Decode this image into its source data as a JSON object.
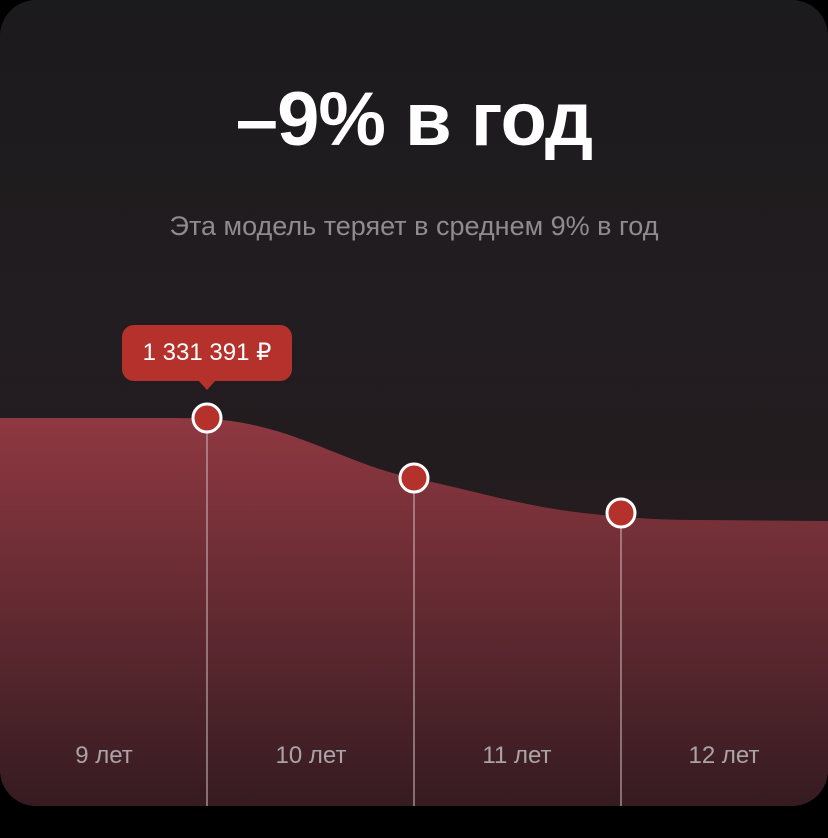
{
  "headline": "–9% в год",
  "subtitle": "Эта модель теряет в среднем 9% в год",
  "tooltip": {
    "value": "1 331 391 ₽"
  },
  "colors": {
    "accent": "#b5312c",
    "area_top": "#8e3740",
    "area_bottom": "#3a1c22",
    "background": "#1b1a1c"
  },
  "chart_data": {
    "type": "area",
    "categories": [
      "9 лет",
      "10 лет",
      "11 лет",
      "12 лет"
    ],
    "points": [
      {
        "label": "9 лет",
        "tooltip": "1 331 391 ₽"
      },
      {
        "label": "10 лет"
      },
      {
        "label": "11 лет"
      }
    ],
    "title": "–9% в год",
    "subtitle": "Эта модель теряет в среднем 9% в год"
  }
}
